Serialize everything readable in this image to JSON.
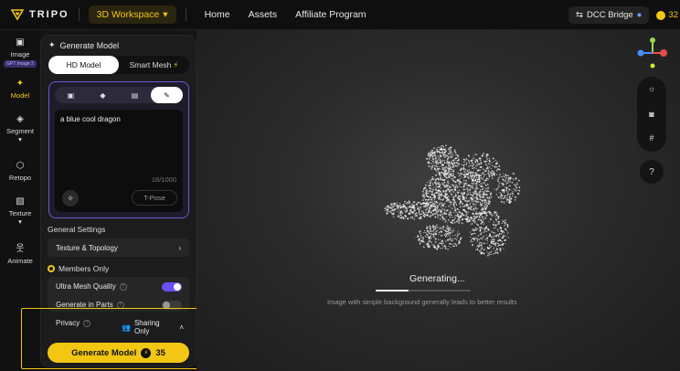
{
  "topbar": {
    "logo_text": "TRIPO",
    "workspace_label": "3D Workspace",
    "nav": [
      "Home",
      "Assets",
      "Affiliate Program"
    ],
    "dcc_label": "DCC Bridge",
    "credits_value": "32"
  },
  "rail": {
    "items": [
      {
        "label": "Image",
        "badge": "GPT Image 2"
      },
      {
        "label": "Model"
      },
      {
        "label": "Segment"
      },
      {
        "label": "Retopo"
      },
      {
        "label": "Texture"
      },
      {
        "label": "Animate"
      }
    ]
  },
  "panel": {
    "title": "Generate Model",
    "modes": [
      "HD Model",
      "Smart Mesh"
    ],
    "prompt": {
      "text": "a blue cool dragon",
      "count": "18/1000",
      "tpose_label": "T-Pose"
    },
    "general_settings_label": "General Settings",
    "texture_topology_label": "Texture & Topology",
    "members_label": "Members Only",
    "ultra_mesh_label": "Ultra Mesh Quality",
    "ultra_mesh_on": true,
    "gen_parts_label": "Generate in Parts",
    "gen_parts_on": false,
    "privacy_label": "Privacy",
    "sharing_label": "Sharing Only",
    "generate_label": "Generate Model",
    "generate_cost": "35"
  },
  "viewport": {
    "status": "Generating...",
    "progress": 0.35,
    "hint": "Image with simple background generally leads to better results"
  },
  "colors": {
    "accent": "#f3c614",
    "purple": "#6a50f5"
  }
}
